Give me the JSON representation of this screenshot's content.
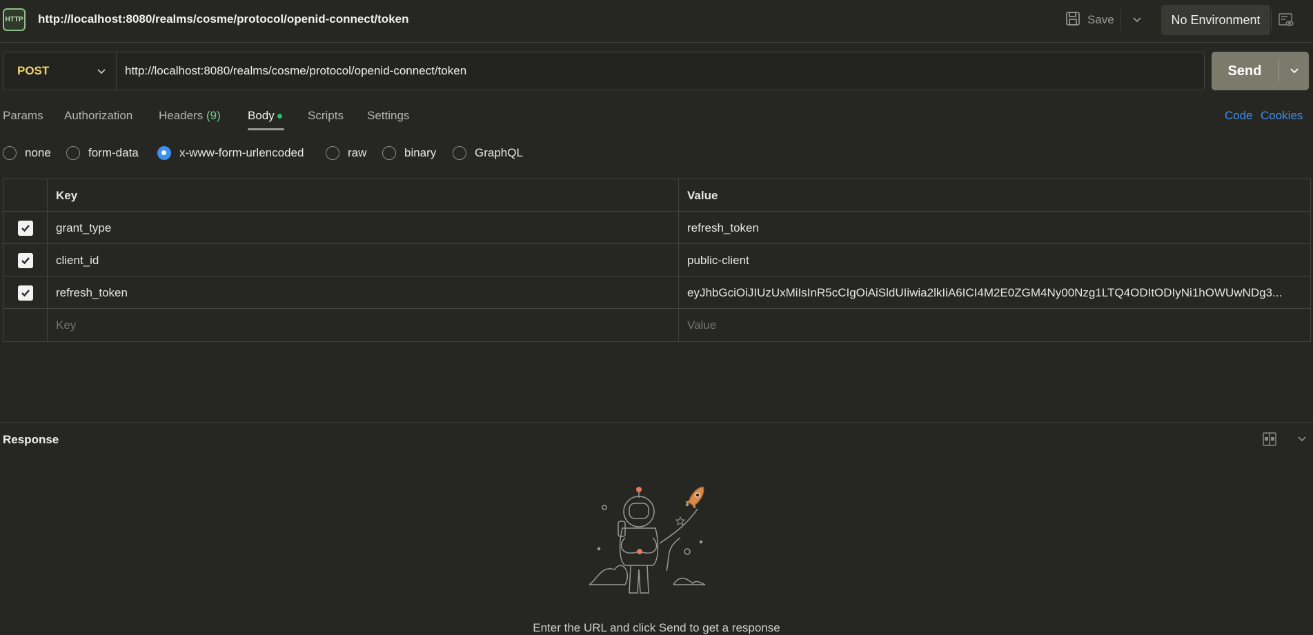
{
  "header": {
    "icon": "http-request-icon",
    "icon_text": "HTTP",
    "title": "http://localhost:8080/realms/cosme/protocol/openid-connect/token",
    "save_label": "Save",
    "environment": "No Environment"
  },
  "request": {
    "method": "POST",
    "url": "http://localhost:8080/realms/cosme/protocol/openid-connect/token",
    "send_label": "Send"
  },
  "tabs": {
    "params": "Params",
    "authorization": "Authorization",
    "headers": "Headers",
    "headers_count": "(9)",
    "body": "Body",
    "scripts": "Scripts",
    "settings": "Settings",
    "active": "Body"
  },
  "links": {
    "code": "Code",
    "cookies": "Cookies"
  },
  "body_types": {
    "none": "none",
    "form_data": "form-data",
    "urlencoded": "x-www-form-urlencoded",
    "raw": "raw",
    "binary": "binary",
    "graphql": "GraphQL",
    "selected": "x-www-form-urlencoded"
  },
  "table": {
    "key_header": "Key",
    "value_header": "Value",
    "rows": [
      {
        "key": "grant_type",
        "value": "refresh_token",
        "checked": true
      },
      {
        "key": "client_id",
        "value": "public-client",
        "checked": true
      },
      {
        "key": "refresh_token",
        "value": "eyJhbGciOiJIUzUxMiIsInR5cCIgOiAiSldUIiwia2lkIiA6ICI4M2E0ZGM4Ny00Nzg1LTQ4ODItODIyNi1hOWUwNDg3...",
        "checked": true
      }
    ],
    "placeholder_key": "Key",
    "placeholder_value": "Value"
  },
  "response": {
    "title": "Response",
    "empty_message": "Enter the URL and click Send to get a response"
  },
  "colors": {
    "background": "#262622",
    "method": "#f3d36b",
    "accent": "#3d8ff0",
    "send_button": "#7c7a6a",
    "body_dot": "#22c55e"
  }
}
